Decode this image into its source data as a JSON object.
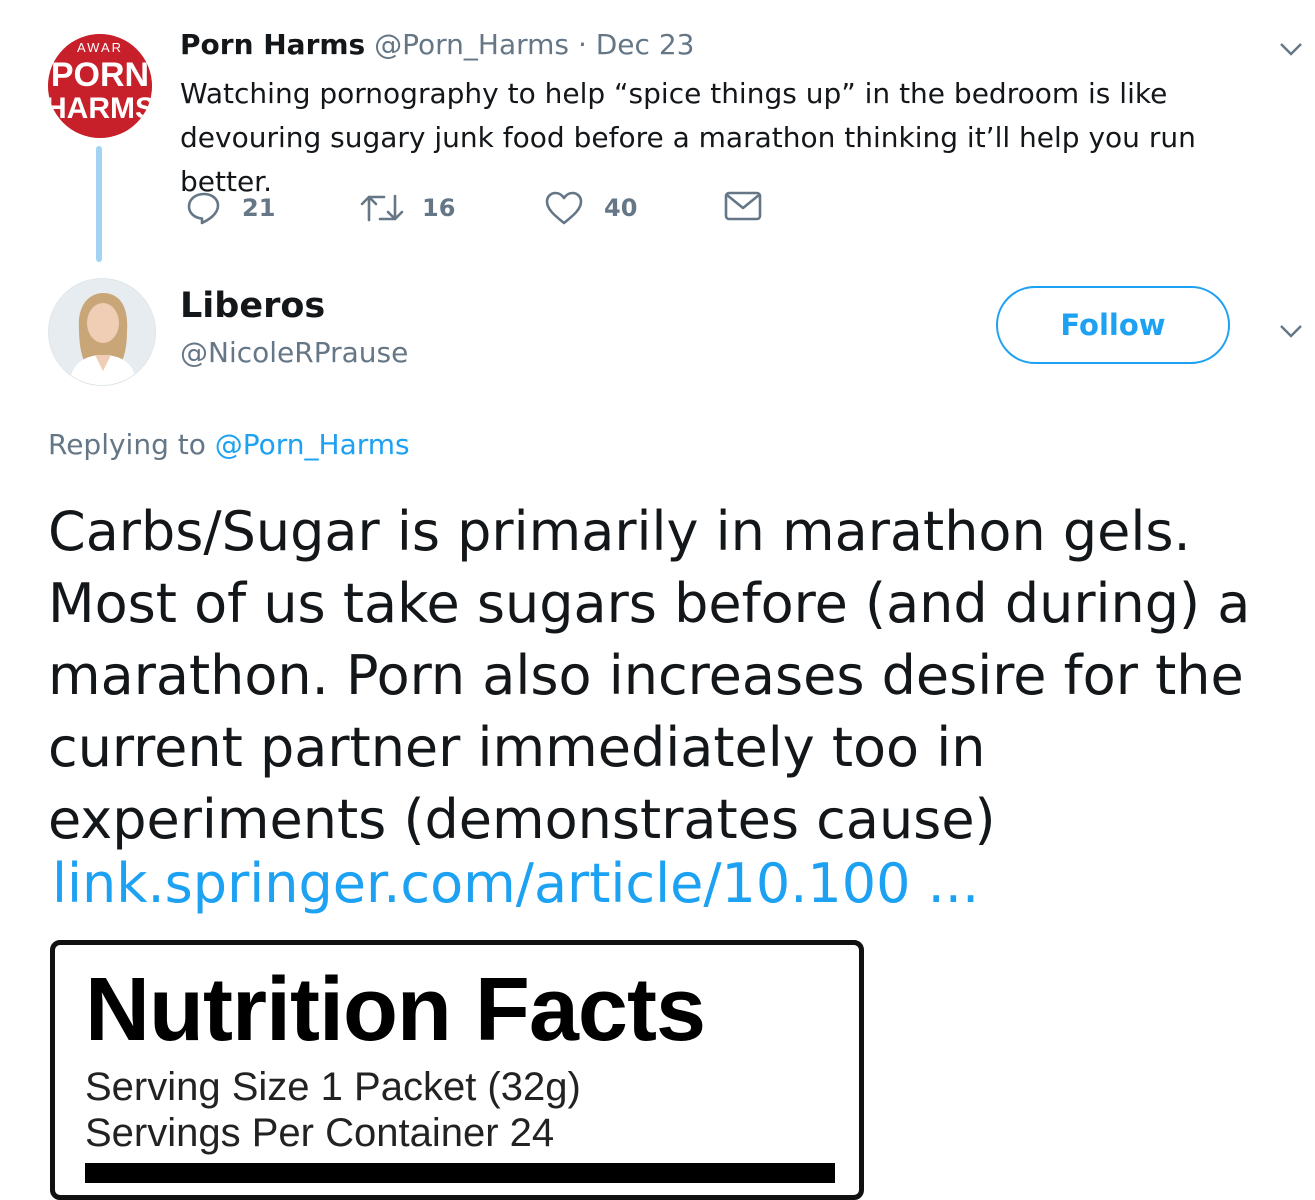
{
  "parent_tweet": {
    "avatar_text": {
      "top": "AWAR",
      "line1": "PORN",
      "line2": "HARMS"
    },
    "name": "Porn Harms",
    "handle": "@Porn_Harms",
    "separator": "·",
    "date": "Dec 23",
    "text": "Watching pornography to help “spice things up” in the bedroom is like devouring sugary junk food before a marathon thinking it’ll help you run better.",
    "actions": {
      "replies": "21",
      "retweets": "16",
      "likes": "40"
    }
  },
  "reply_tweet": {
    "name": "Liberos",
    "handle": "@NicoleRPrause",
    "follow_label": "Follow",
    "replying_prefix": "Replying to",
    "replying_to": "@Porn_Harms",
    "text": "Carbs/Sugar is primarily in marathon gels. Most of us take sugars before (and during) a marathon. Porn also increases desire for the current partner immediately too in experiments (demonstrates cause)",
    "link": "link.springer.com/article/10.100 ...",
    "media": {
      "title": "Nutrition Facts",
      "serving_size": "Serving Size 1 Packet (32g)",
      "servings_per_container": "Servings Per Container 24"
    }
  },
  "colors": {
    "accent": "#1da1f2",
    "muted": "#657786",
    "text": "#14171a",
    "thread_line": "#a3d3f2",
    "logo_red": "#c8202a"
  },
  "icons": [
    "reply-icon",
    "retweet-icon",
    "like-icon",
    "dm-icon",
    "chevron-down-icon"
  ]
}
